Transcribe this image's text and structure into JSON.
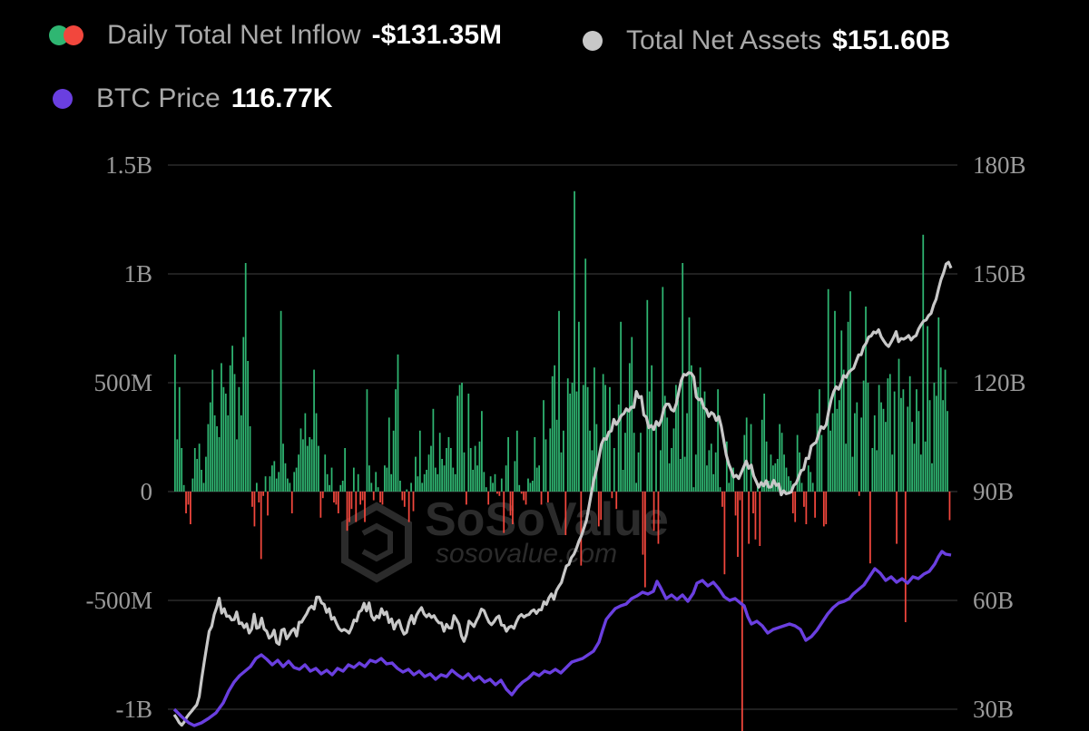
{
  "legend": {
    "inflow": {
      "label": "Daily Total Net Inflow",
      "value": "-$131.35M",
      "color_pos": "#2fb672",
      "color_neg": "#f2473d"
    },
    "assets": {
      "label": "Total Net Assets",
      "value": "$151.60B",
      "color": "#c8c8c8"
    },
    "btc": {
      "label": "BTC Price",
      "value": "116.77K",
      "color": "#6a3fe0"
    }
  },
  "watermark": {
    "logo_text": "SoSoValue",
    "url_text": "sosovalue.com"
  },
  "chart_data": {
    "type": "bar",
    "left_axis": {
      "ticks": [
        "1.5B",
        "1B",
        "500M",
        "0",
        "-500M",
        "-1B"
      ],
      "tick_values": [
        1500,
        1000,
        500,
        0,
        -500,
        -1000
      ],
      "unit": "M USD"
    },
    "right_axis": {
      "ticks": [
        "180B",
        "150B",
        "120B",
        "90B",
        "60B",
        "30B"
      ],
      "tick_values": [
        180,
        150,
        120,
        90,
        60,
        30
      ],
      "unit": "B USD"
    },
    "grid": true,
    "series": [
      {
        "name": "Daily Total Net Inflow",
        "type": "bar",
        "axis": "left",
        "unit": "M USD",
        "values": [
          630,
          240,
          480,
          200,
          30,
          -100,
          -60,
          -150,
          60,
          200,
          150,
          220,
          100,
          40,
          160,
          310,
          410,
          560,
          350,
          300,
          250,
          590,
          480,
          450,
          350,
          580,
          670,
          540,
          240,
          480,
          350,
          710,
          1050,
          600,
          300,
          -70,
          -160,
          40,
          -50,
          -310,
          -20,
          70,
          -110,
          70,
          120,
          140,
          60,
          90,
          830,
          220,
          130,
          60,
          40,
          -100,
          90,
          110,
          170,
          290,
          240,
          360,
          210,
          250,
          240,
          560,
          360,
          210,
          -120,
          -30,
          170,
          80,
          30,
          110,
          -50,
          -60,
          -100,
          30,
          50,
          200,
          -180,
          -140,
          -80,
          110,
          -140,
          80,
          -60,
          -40,
          -140,
          470,
          120,
          40,
          -40,
          90,
          20,
          -50,
          -60,
          120,
          110,
          340,
          80,
          280,
          470,
          630,
          50,
          -40,
          -70,
          10,
          -140,
          40,
          -90,
          160,
          70,
          280,
          40,
          80,
          100,
          170,
          210,
          380,
          110,
          80,
          270,
          150,
          120,
          200,
          250,
          200,
          110,
          80,
          440,
          490,
          500,
          180,
          -60,
          450,
          200,
          100,
          210,
          120,
          230,
          370,
          90,
          20,
          -60,
          70,
          40,
          80,
          -10,
          -20,
          60,
          -190,
          120,
          250,
          -110,
          -150,
          140,
          280,
          30,
          -10,
          -40,
          -60,
          60,
          40,
          50,
          250,
          110,
          120,
          -60,
          420,
          240,
          -50,
          290,
          530,
          580,
          330,
          830,
          180,
          280,
          -200,
          520,
          450,
          500,
          1380,
          460,
          780,
          -340,
          490,
          1070,
          480,
          280,
          190,
          570,
          310,
          -160,
          -130,
          540,
          490,
          260,
          480,
          -30,
          200,
          -80,
          400,
          780,
          100,
          270,
          380,
          590,
          710,
          270,
          40,
          180,
          270,
          -290,
          -440,
          880,
          460,
          580,
          -180,
          320,
          -240,
          190,
          940,
          440,
          340,
          130,
          200,
          290,
          490,
          420,
          150,
          1050,
          160,
          360,
          800,
          580,
          20,
          170,
          480,
          570,
          390,
          460,
          120,
          190,
          220,
          80,
          180,
          470,
          20,
          -70,
          -380,
          230,
          40,
          110,
          110,
          -110,
          -300,
          -40,
          -1100,
          260,
          340,
          -240,
          310,
          -100,
          -220,
          40,
          -250,
          330,
          450,
          230,
          50,
          170,
          120,
          130,
          150,
          310,
          270,
          170,
          110,
          70,
          50,
          -100,
          -140,
          260,
          180,
          40,
          -70,
          -150,
          120,
          90,
          40,
          -120,
          360,
          470,
          260,
          -160,
          -150,
          930,
          280,
          360,
          830,
          380,
          420,
          740,
          560,
          220,
          780,
          920,
          160,
          360,
          410,
          -20,
          340,
          510,
          850,
          500,
          -330,
          200,
          350,
          190,
          490,
          410,
          380,
          320,
          520,
          540,
          170,
          460,
          -240,
          610,
          430,
          470,
          -600,
          390,
          530,
          320,
          220,
          470,
          370,
          170,
          1180,
          230,
          760,
          420,
          130,
          500,
          440,
          800,
          570,
          420,
          560,
          370,
          -131.35
        ]
      },
      {
        "name": "Total Net Assets",
        "type": "line",
        "axis": "right",
        "unit": "B USD",
        "values": [
          28.5,
          27.5,
          26.3,
          25.6,
          26.5,
          27.8,
          28.7,
          29.5,
          30.4,
          31.2,
          33.5,
          38.5,
          43.0,
          47.3,
          51.5,
          52.8,
          56.1,
          58.1,
          60.6,
          56.5,
          57.7,
          55.6,
          55.7,
          54.6,
          54.7,
          56.8,
          53.6,
          53.8,
          52.5,
          53.5,
          51.0,
          52.1,
          56.2,
          52.3,
          52.6,
          55.1,
          52.1,
          51.5,
          49.6,
          50.2,
          51.8,
          48.4,
          47.9,
          51.8,
          52.1,
          49.4,
          50.4,
          51.6,
          52.2,
          50.2,
          54.0,
          54.0,
          55.2,
          56.3,
          57.8,
          58.4,
          57.6,
          60.9,
          60.9,
          59.3,
          58.9,
          56.7,
          57.7,
          54.8,
          55.3,
          53.6,
          52.2,
          51.6,
          52.0,
          51.6,
          51.0,
          52.5,
          54.6,
          54.3,
          56.8,
          57.3,
          59.2,
          57.1,
          59.3,
          55.7,
          54.6,
          55.7,
          55.2,
          57.7,
          56.1,
          56.8,
          53.9,
          54.9,
          52.1,
          53.8,
          54.5,
          52.2,
          50.7,
          51.2,
          54.0,
          55.8,
          53.6,
          55.9,
          57.1,
          58.0,
          56.3,
          55.5,
          56.2,
          55.3,
          55.8,
          54.6,
          53.8,
          53.8,
          51.5,
          53.4,
          52.4,
          52.4,
          55.8,
          54.7,
          53.4,
          50.2,
          48.7,
          50.6,
          54.3,
          53.6,
          52.8,
          54.4,
          55.7,
          57.6,
          57.2,
          55.5,
          54.0,
          53.3,
          54.1,
          55.2,
          55.7,
          53.2,
          53.1,
          51.5,
          52.6,
          52.9,
          52.3,
          54.1,
          55.5,
          56.1,
          55.4,
          55.9,
          56.1,
          57.0,
          57.4,
          56.4,
          57.4,
          57.4,
          59.6,
          58.9,
          60.7,
          61.8,
          60.3,
          62.7,
          63.9,
          64.9,
          67.3,
          69.5,
          69.9,
          71.8,
          72.7,
          74.3,
          76.3,
          77.8,
          79.9,
          82.0,
          85.7,
          89.6,
          93.3,
          95.9,
          99.3,
          103.0,
          104.6,
          104.4,
          106.4,
          106.7,
          109.9,
          108.5,
          109.6,
          111.0,
          111.5,
          112.8,
          112.2,
          113.3,
          113.2,
          117.6,
          115.9,
          116.2,
          111.1,
          110.5,
          107.6,
          108.2,
          107.1,
          109.3,
          108.2,
          109.8,
          112.8,
          114.1,
          114.1,
          112.6,
          112.2,
          114.2,
          117.5,
          120.7,
          122.3,
          122.1,
          122.8,
          122.6,
          121.6,
          116.1,
          115.3,
          115.5,
          113.1,
          112.6,
          110.7,
          111.8,
          111.3,
          109.6,
          110.7,
          108.0,
          104.1,
          100.1,
          97.6,
          95.9,
          94.0,
          94.5,
          93.6,
          95.2,
          96.8,
          98.4,
          96.4,
          97.3,
          94.3,
          92.8,
          91.2,
          92.5,
          91.6,
          93.0,
          91.2,
          91.3,
          93.1,
          91.7,
          92.1,
          89.1,
          90.2,
          89.4,
          89.6,
          89.9,
          91.7,
          92.3,
          94.0,
          95.8,
          96.1,
          99.2,
          99.1,
          102.5,
          103.1,
          103.6,
          105.9,
          107.9,
          107.4,
          108.4,
          112.1,
          115.3,
          117.5,
          118.9,
          118.2,
          119.9,
          122.0,
          121.5,
          122.9,
          123.5,
          124.0,
          125.9,
          127.7,
          127.7,
          129.9,
          130.9,
          132.6,
          132.9,
          134.0,
          133.7,
          134.6,
          132.7,
          131.6,
          130.6,
          130.0,
          131.2,
          132.5,
          134.1,
          131.3,
          132.2,
          132.0,
          132.4,
          133.0,
          131.8,
          132.6,
          133.0,
          134.8,
          136.0,
          137.0,
          137.3,
          138.5,
          139.1,
          141.4,
          143.0,
          145.9,
          148.5,
          150.3,
          152.7,
          153.2,
          151.6
        ]
      },
      {
        "name": "BTC Price",
        "type": "line",
        "axis": "none",
        "values": []
      }
    ]
  }
}
